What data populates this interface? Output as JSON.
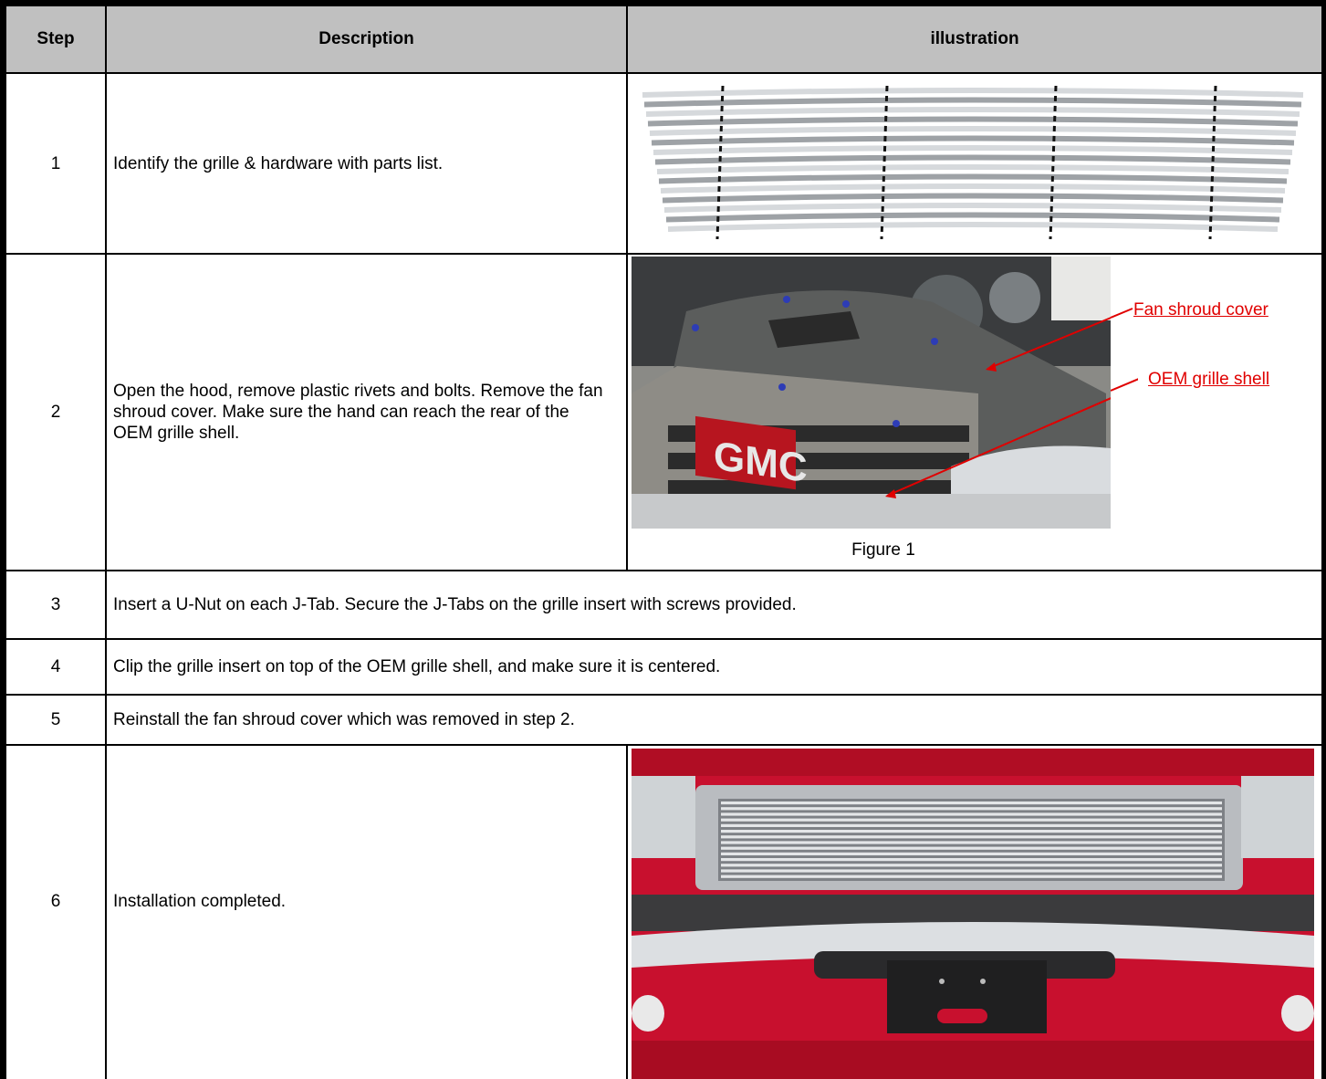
{
  "table": {
    "headers": {
      "step": "Step",
      "description": "Description",
      "illustration": "illustration"
    },
    "rows": [
      {
        "step": "1",
        "description": "Identify the grille & hardware with parts list."
      },
      {
        "step": "2",
        "description": "Open the hood, remove plastic rivets and bolts. Remove the fan shroud cover. Make sure the hand can reach the rear of the OEM grille shell."
      },
      {
        "step": "3",
        "description": "Insert a U-Nut on each J-Tab. Secure the J-Tabs on the grille insert with screws provided."
      },
      {
        "step": "4",
        "description": "Clip the grille insert on top of the OEM grille shell, and make sure it is centered."
      },
      {
        "step": "5",
        "description": "Reinstall the fan shroud cover which was removed in step 2."
      },
      {
        "step": "6",
        "description": "Installation completed."
      }
    ]
  },
  "figure1": {
    "label_fan": "Fan shroud cover",
    "label_shell": "OEM grille shell",
    "caption": "Figure 1",
    "badge": "GMC"
  },
  "colors": {
    "header_bg": "#c0c0c0",
    "annotation": "#e00000",
    "truck_red": "#c8102e"
  }
}
